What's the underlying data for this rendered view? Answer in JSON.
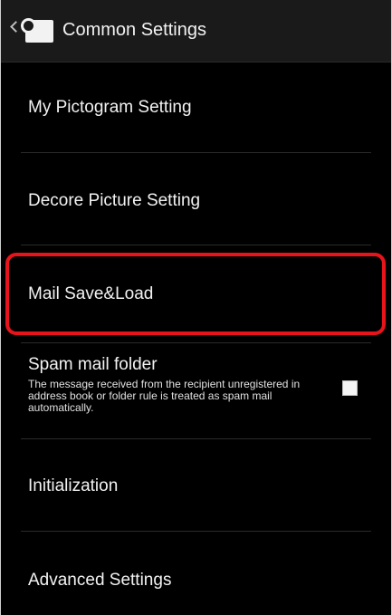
{
  "action_bar": {
    "title": "Common Settings",
    "back_icon": "chevron-left",
    "app_icon": "mail-app-icon"
  },
  "settings": [
    {
      "label": "My Pictogram Setting"
    },
    {
      "label": "Decore Picture Setting"
    },
    {
      "label": "Mail Save&Load",
      "highlighted": true,
      "highlight_color": "#e8141b"
    },
    {
      "label": "Spam mail folder",
      "description": "The message received from the recipient unregistered in address book or folder rule is treated as spam mail automatically.",
      "checked": false
    },
    {
      "label": "Initialization"
    },
    {
      "label": "Advanced Settings"
    }
  ]
}
